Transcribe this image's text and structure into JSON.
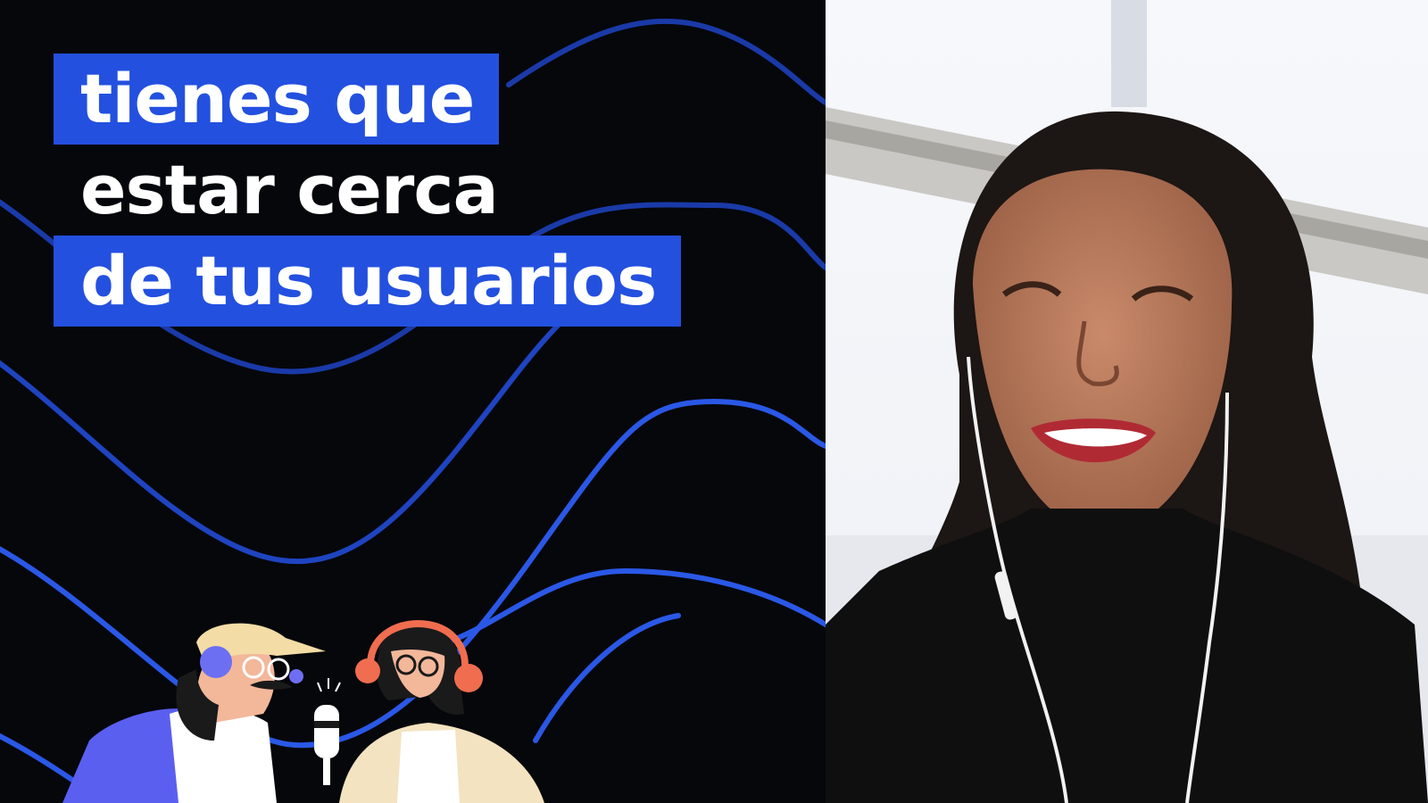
{
  "caption": {
    "line1": "tienes que",
    "line2": "estar cerca",
    "line3": "de tus usuarios"
  },
  "colors": {
    "background": "#06070b",
    "highlight": "#2350df",
    "wave_bright": "#2a58e6",
    "wave_dim": "#1a3aa8",
    "text": "#ffffff"
  },
  "icons": {
    "illustration": "podcast-hosts-illustration",
    "video": "speaker-video-feed"
  }
}
